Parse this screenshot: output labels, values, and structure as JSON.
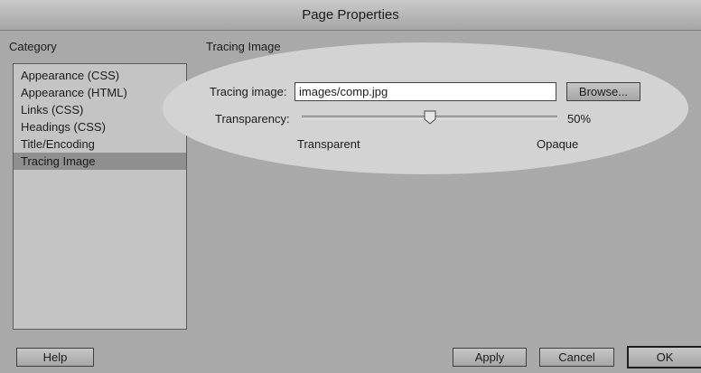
{
  "window": {
    "title": "Page Properties"
  },
  "category": {
    "heading": "Category",
    "items": [
      {
        "label": "Appearance (CSS)",
        "selected": false
      },
      {
        "label": "Appearance (HTML)",
        "selected": false
      },
      {
        "label": "Links (CSS)",
        "selected": false
      },
      {
        "label": "Headings (CSS)",
        "selected": false
      },
      {
        "label": "Title/Encoding",
        "selected": false
      },
      {
        "label": "Tracing Image",
        "selected": true
      }
    ]
  },
  "panel": {
    "heading": "Tracing Image",
    "tracing_image": {
      "label": "Tracing image:",
      "value": "images/comp.jpg",
      "browse_label": "Browse..."
    },
    "transparency": {
      "label": "Transparency:",
      "level_percent": 50,
      "value_label": "50%",
      "min_label": "Transparent",
      "max_label": "Opaque"
    }
  },
  "footer": {
    "help_label": "Help",
    "apply_label": "Apply",
    "cancel_label": "Cancel",
    "ok_label": "OK"
  },
  "colors": {
    "dialog_background": "#a9a9a9",
    "highlight": "#d3d3d3",
    "selected_item": "#8f8f8f"
  },
  "icons": {
    "slider_thumb": "slider-thumb-icon"
  }
}
